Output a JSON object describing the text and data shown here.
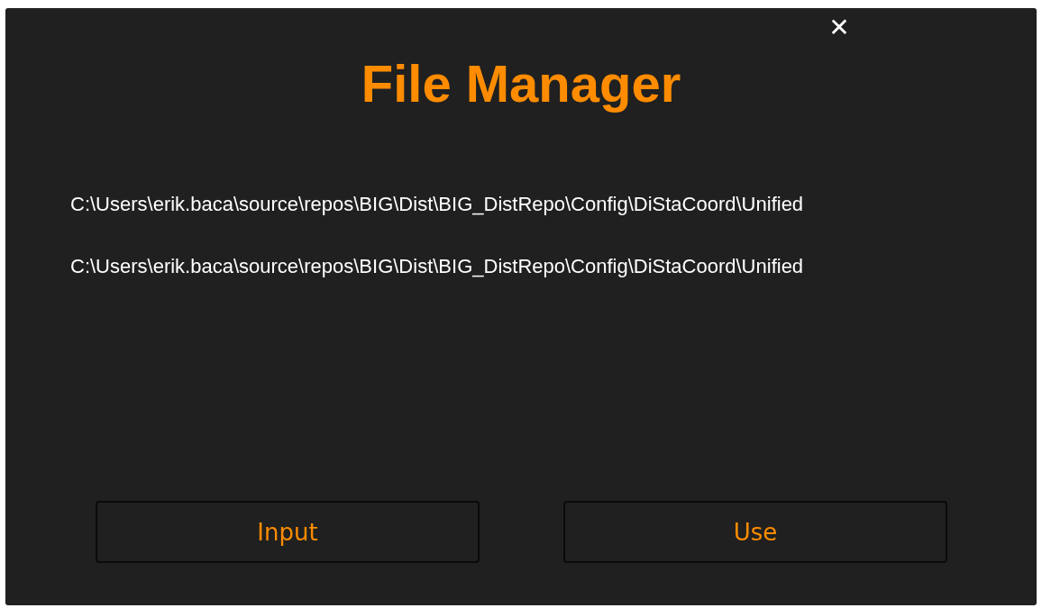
{
  "window": {
    "title": "File Manager",
    "close": "✕"
  },
  "paths": [
    "C:\\Users\\erik.baca\\source\\repos\\BIG\\Dist\\BIG_DistRepo\\Config\\DiStaCoord\\Unified",
    "C:\\Users\\erik.baca\\source\\repos\\BIG\\Dist\\BIG_DistRepo\\Config\\DiStaCoord\\Unified"
  ],
  "buttons": [
    "Input",
    "Use"
  ]
}
